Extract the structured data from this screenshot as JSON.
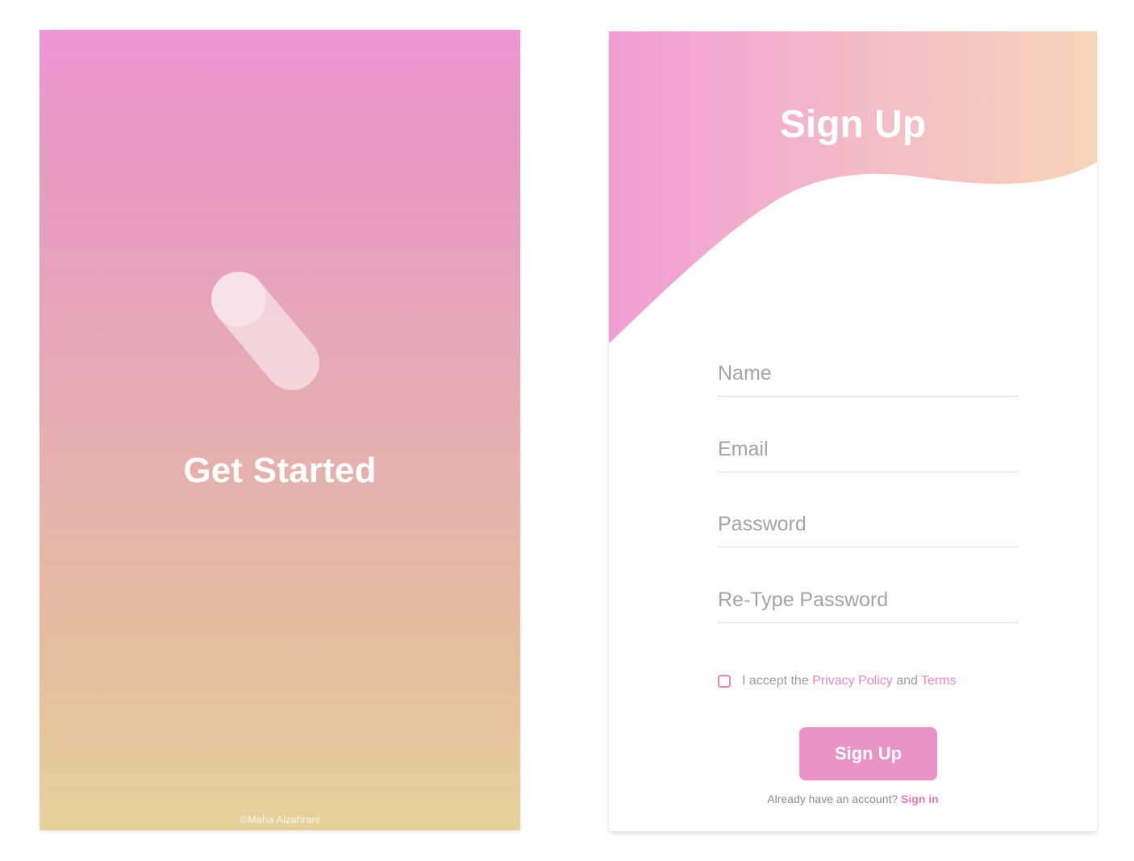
{
  "get_started": {
    "title": "Get Started",
    "copyright": "©Maha Alzahrani",
    "logo_icon": "v-logo-icon",
    "gradient": [
      "#f096d4",
      "#e5d29a"
    ]
  },
  "signup": {
    "title": "Sign Up",
    "fields": [
      {
        "placeholder": "Name",
        "value": ""
      },
      {
        "placeholder": "Email",
        "value": ""
      },
      {
        "placeholder": "Password",
        "value": ""
      },
      {
        "placeholder": "Re-Type Password",
        "value": ""
      }
    ],
    "terms": {
      "checked": false,
      "prefix": "I accept the ",
      "privacy_label": "Privacy Policy",
      "middle": " and ",
      "terms_label": "Terms"
    },
    "button_label": "Sign Up",
    "signin_prompt": "Already have an account? ",
    "signin_label": "Sign in",
    "colors": {
      "accent": "#e993c8",
      "link": "#e789c2",
      "header_gradient": [
        "#ee9ed4",
        "#f6d4b8"
      ]
    }
  }
}
